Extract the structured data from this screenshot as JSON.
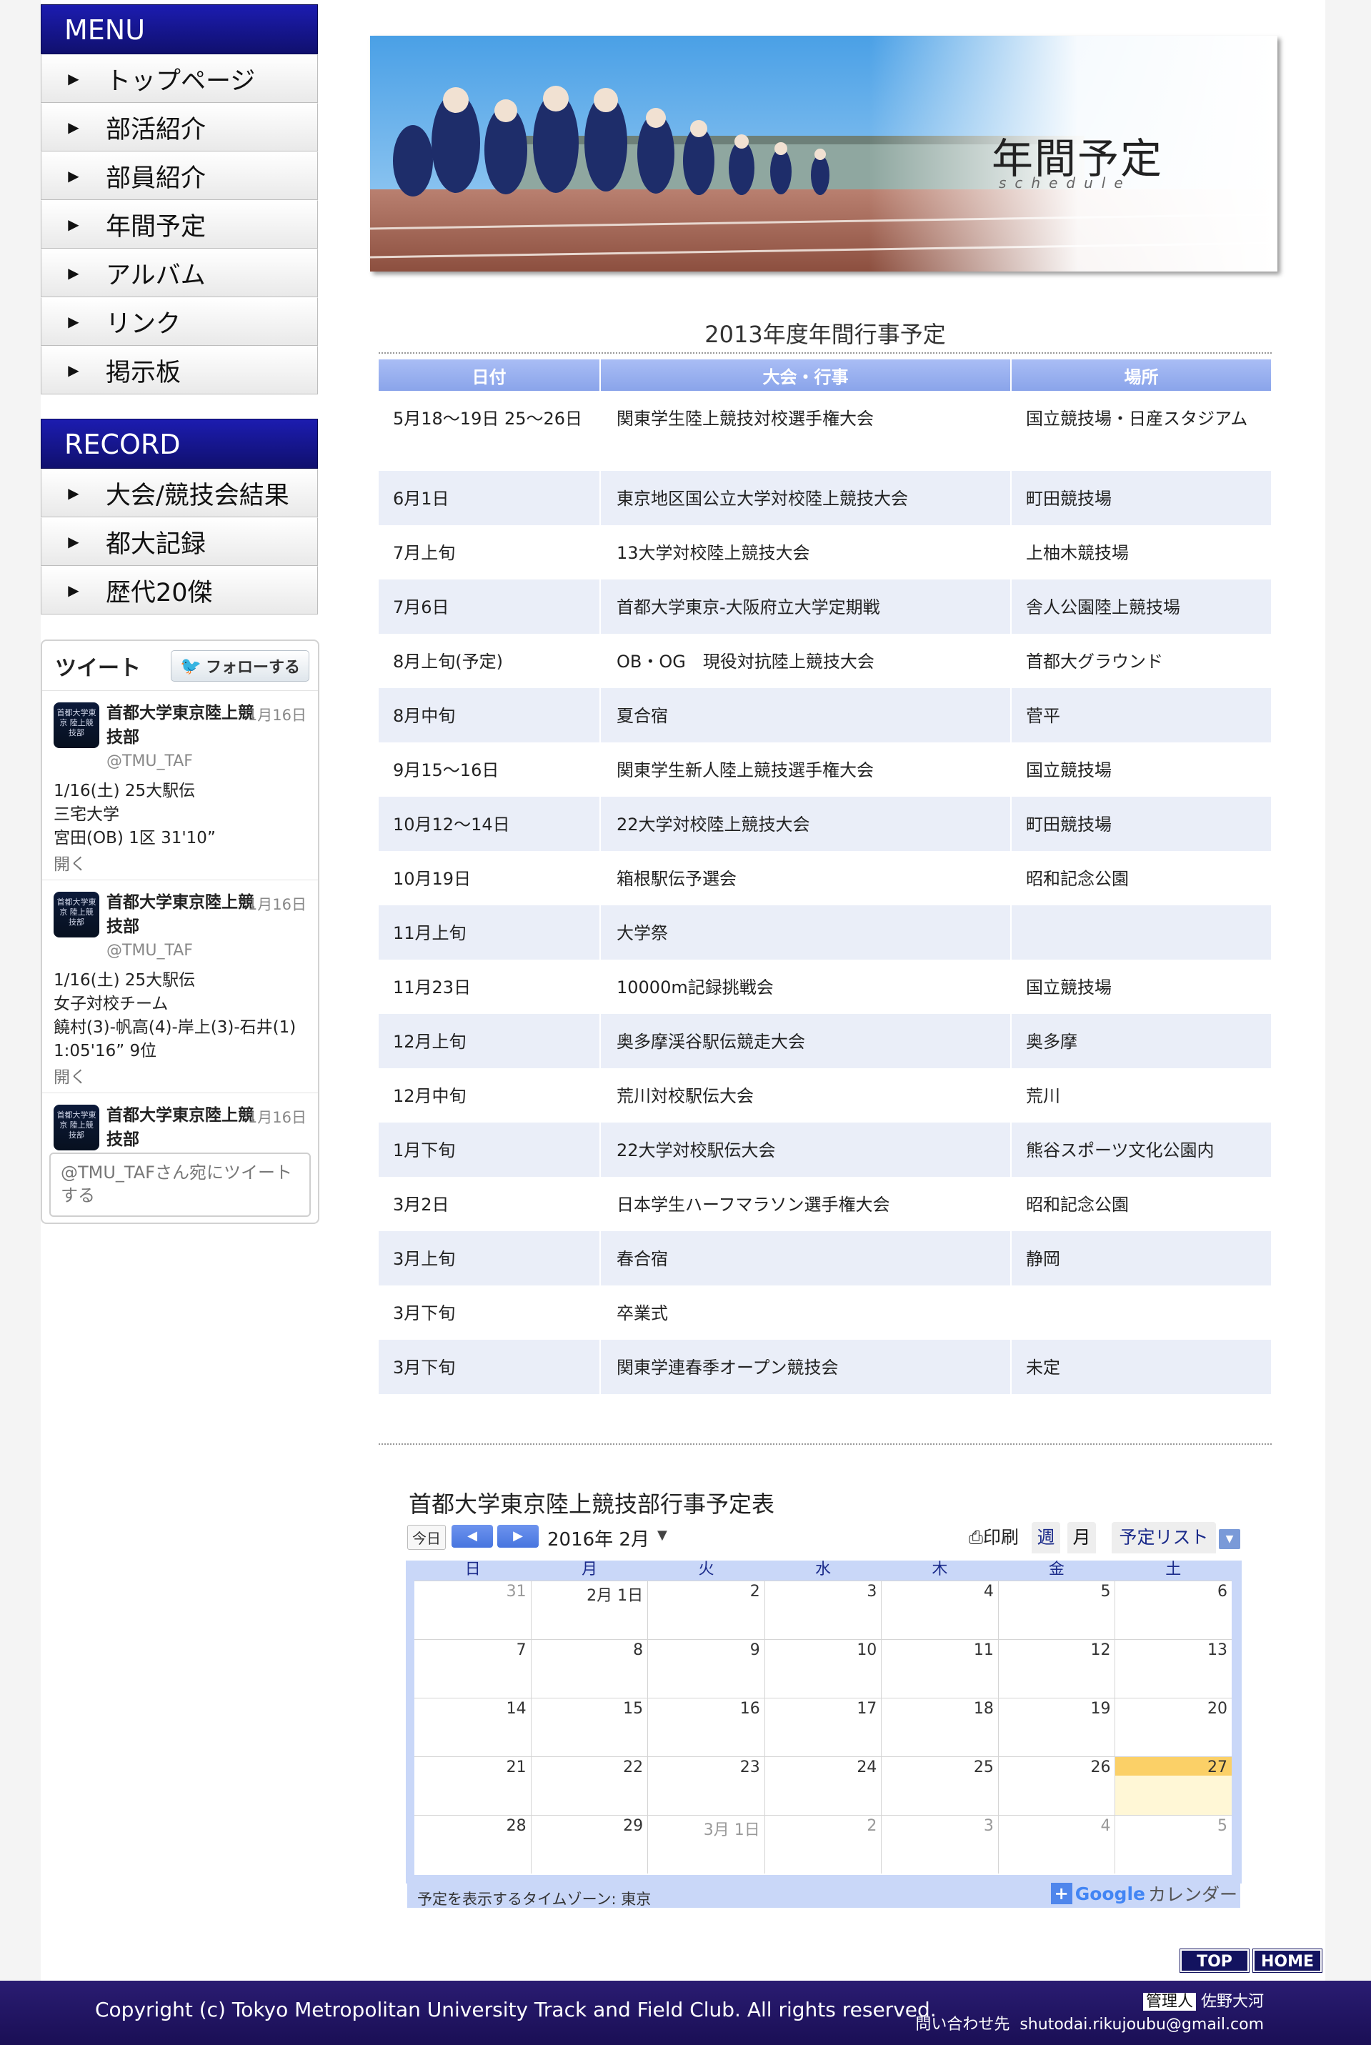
{
  "menu": {
    "title": "MENU",
    "items": [
      "トップページ",
      "部活紹介",
      "部員紹介",
      "年間予定",
      "アルバム",
      "リンク",
      "掲示板"
    ]
  },
  "record": {
    "title": "RECORD",
    "items": [
      "大会/競技会結果",
      "都大記録",
      "歴代20傑"
    ]
  },
  "twitter": {
    "title": "ツイート",
    "follow_label": "フォローする",
    "tweets": [
      {
        "name": "首都大学東京陸上競技部",
        "date": "1月16日",
        "handle": "@TMU_TAF",
        "text": [
          "1/16(土) 25大駅伝",
          "三宅大学",
          "宮田(OB) 1区 31'10”"
        ],
        "open": "開く"
      },
      {
        "name": "首都大学東京陸上競技部",
        "date": "1月16日",
        "handle": "@TMU_TAF",
        "text": [
          "1/16(土) 25大駅伝",
          "女子対校チーム",
          "饒村(3)-帆高(4)-岸上(3)-石井(1)",
          "1:05'16” 9位"
        ],
        "open": "開く"
      },
      {
        "name": "首都大学東京陸上競技部",
        "date": "1月16日"
      }
    ],
    "avatar_text": "首都大学東京 陸上競技部",
    "input_placeholder": "@TMU_TAFさん宛にツイートする"
  },
  "banner": {
    "title": "年間予定",
    "subtitle": "schedule"
  },
  "schedule": {
    "title": "2013年度年間行事予定",
    "headers": [
      "日付",
      "大会・行事",
      "場所"
    ],
    "rows": [
      [
        "5月18〜19日 25〜26日",
        "関東学生陸上競技対校選手権大会",
        "国立競技場・日産スタジアム"
      ],
      [
        "6月1日",
        "東京地区国公立大学対校陸上競技大会",
        "町田競技場"
      ],
      [
        "7月上旬",
        "13大学対校陸上競技大会",
        "上柚木競技場"
      ],
      [
        "7月6日",
        "首都大学東京-大阪府立大学定期戦",
        "舎人公園陸上競技場"
      ],
      [
        "8月上旬(予定)",
        "OB・OG　現役対抗陸上競技大会",
        "首都大グラウンド"
      ],
      [
        "8月中旬",
        "夏合宿",
        "菅平"
      ],
      [
        "9月15〜16日",
        "関東学生新人陸上競技選手権大会",
        "国立競技場"
      ],
      [
        "10月12〜14日",
        "22大学対校陸上競技大会",
        "町田競技場"
      ],
      [
        "10月19日",
        "箱根駅伝予選会",
        "昭和記念公園"
      ],
      [
        "11月上旬",
        "大学祭",
        ""
      ],
      [
        "11月23日",
        "10000m記録挑戦会",
        "国立競技場"
      ],
      [
        "12月上旬",
        "奥多摩渓谷駅伝競走大会",
        "奥多摩"
      ],
      [
        "12月中旬",
        "荒川対校駅伝大会",
        "荒川"
      ],
      [
        "1月下旬",
        "22大学対校駅伝大会",
        "熊谷スポーツ文化公園内"
      ],
      [
        "3月2日",
        "日本学生ハーフマラソン選手権大会",
        "昭和記念公園"
      ],
      [
        "3月上旬",
        "春合宿",
        "静岡"
      ],
      [
        "3月下旬",
        "卒業式",
        ""
      ],
      [
        "3月下旬",
        "関東学連春季オープン競技会",
        "未定"
      ]
    ]
  },
  "calendar": {
    "title": "首都大学東京陸上競技部行事予定表",
    "today_label": "今日",
    "prev_icon": "◀",
    "next_icon": "▶",
    "month_label": "2016年 2月",
    "print_label": "印刷",
    "tab_week": "週",
    "tab_month": "月",
    "tab_list": "予定リスト",
    "days_of_week": [
      "日",
      "月",
      "火",
      "水",
      "木",
      "金",
      "土"
    ],
    "weeks": [
      [
        "31",
        "2月 1日",
        "2",
        "3",
        "4",
        "5",
        "6"
      ],
      [
        "7",
        "8",
        "9",
        "10",
        "11",
        "12",
        "13"
      ],
      [
        "14",
        "15",
        "16",
        "17",
        "18",
        "19",
        "20"
      ],
      [
        "21",
        "22",
        "23",
        "24",
        "25",
        "26",
        "27"
      ],
      [
        "28",
        "29",
        "3月 1日",
        "2",
        "3",
        "4",
        "5"
      ]
    ],
    "timezone_label": "予定を表示するタイムゾーン: 東京",
    "gcal_google": "Google",
    "gcal_label": "カレンダー"
  },
  "footer": {
    "top_label": "TOP",
    "home_label": "HOME",
    "copyright": "Copyright (c) Tokyo Metropolitan University Track and Field Club. All rights reserved.",
    "admin_tag": "管理人",
    "admin_name": "佐野大河",
    "contact_label": "問い合わせ先",
    "contact_email": "shutodai.rikujoubu@gmail.com"
  }
}
